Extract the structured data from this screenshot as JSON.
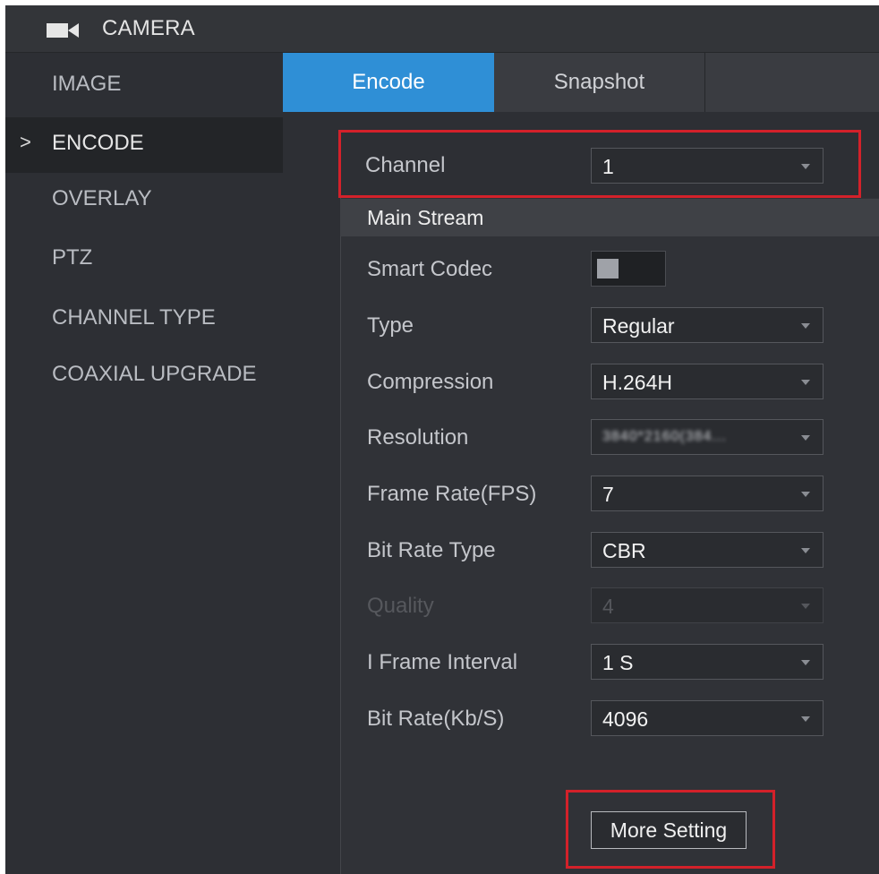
{
  "header": {
    "title": "CAMERA",
    "icon": "video-camera-icon"
  },
  "sidebar": {
    "items": [
      {
        "label": "IMAGE",
        "active": false
      },
      {
        "label": "ENCODE",
        "active": true
      },
      {
        "label": "OVERLAY",
        "active": false
      },
      {
        "label": "PTZ",
        "active": false
      },
      {
        "label": "CHANNEL TYPE",
        "active": false
      },
      {
        "label": "COAXIAL UPGRADE",
        "active": false
      }
    ],
    "active_marker": ">"
  },
  "tabs": [
    {
      "label": "Encode",
      "active": true
    },
    {
      "label": "Snapshot",
      "active": false
    }
  ],
  "channel": {
    "label": "Channel",
    "value": "1"
  },
  "main_stream": {
    "heading": "Main Stream",
    "smart_codec": {
      "label": "Smart Codec",
      "enabled": false
    },
    "type": {
      "label": "Type",
      "value": "Regular"
    },
    "compression": {
      "label": "Compression",
      "value": "H.264H"
    },
    "resolution": {
      "label": "Resolution",
      "value": "3840*2160(384..."
    },
    "frame_rate": {
      "label": "Frame Rate(FPS)",
      "value": "7"
    },
    "bit_rate_type": {
      "label": "Bit Rate Type",
      "value": "CBR"
    },
    "quality": {
      "label": "Quality",
      "value": "4",
      "disabled": true
    },
    "i_frame_interval": {
      "label": "I Frame Interval",
      "value": "1 S"
    },
    "bit_rate": {
      "label": "Bit Rate(Kb/S)",
      "value": "4096"
    }
  },
  "more_setting_label": "More Setting",
  "colors": {
    "accent": "#2f8fd6",
    "highlight": "#d3212a",
    "background": "#2d2f34"
  }
}
